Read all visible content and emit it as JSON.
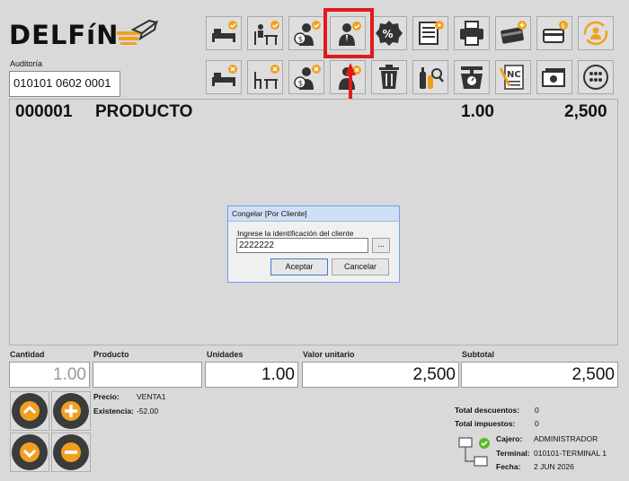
{
  "brand": {
    "name": "DELFíN"
  },
  "auditoria": {
    "label": "Auditoría",
    "value": "010101 0602 0001"
  },
  "toolbar": {
    "top_row": [
      "bed-check-icon",
      "desk-check-icon",
      "client-money-check-icon",
      "user-check-icon",
      "percent-badge-icon",
      "document-eye-icon",
      "printer-icon",
      "card-plus-icon",
      "card-dollar-icon",
      "rotate-user-icon"
    ],
    "bottom_row": [
      "bed-x-icon",
      "desk-x-icon",
      "client-money-x-icon",
      "user-x-icon",
      "trash-icon",
      "bottles-search-icon",
      "scale-icon",
      "credit-note-icon",
      "cash-icon",
      "more-dots-icon"
    ]
  },
  "item_row": {
    "code": "000001",
    "product": "PRODUCTO",
    "qty": "1.00",
    "total": "2,500"
  },
  "labels": {
    "cantidad": "Cantidad",
    "producto": "Producto",
    "unidades": "Unidades",
    "valor_unitario": "Valor unitario",
    "subtotal": "Subtotal"
  },
  "fields": {
    "cantidad": "1.00",
    "producto": "",
    "unidades": "1.00",
    "valor_unitario": "2,500",
    "subtotal": "2,500"
  },
  "info": {
    "precio_label": "Precio:",
    "precio_value": "VENTA1",
    "existencia_label": "Existencia:",
    "existencia_value": "-52.00"
  },
  "totals": {
    "descuentos_label": "Total descuentos:",
    "descuentos_value": "0",
    "impuestos_label": "Total impuestos:",
    "impuestos_value": "0"
  },
  "session": {
    "cajero_label": "Cajero:",
    "cajero_value": "ADMINISTRADOR",
    "terminal_label": "Terminal:",
    "terminal_value": "010101-TERMINAL 1",
    "fecha_label": "Fecha:",
    "fecha_value": "2 JUN 2026"
  },
  "dialog": {
    "title": "Congelar [Por Cliente]",
    "prompt": "Ingrese la identificación del cliente",
    "input_value": "2222222",
    "browse_label": "...",
    "ok_label": "Aceptar",
    "cancel_label": "Cancelar"
  },
  "colors": {
    "accent": "#f0a020",
    "highlight": "#e11a1a",
    "icon_dark": "#333333"
  }
}
